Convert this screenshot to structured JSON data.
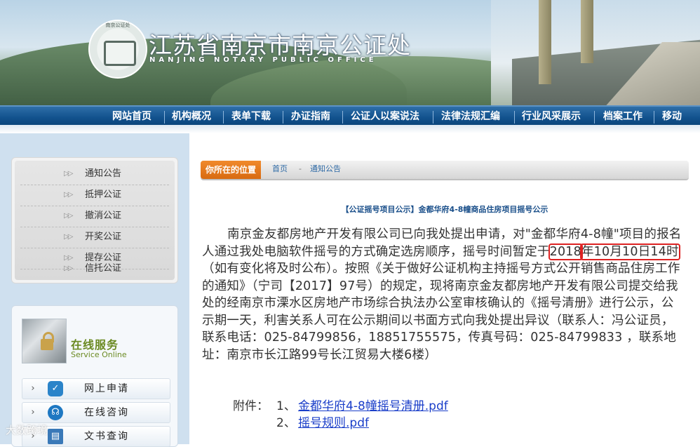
{
  "header": {
    "title": "江苏省南京市南京公证处",
    "subtitle": "NANJING NOTARY PUBLIC OFFICE",
    "logo_ring_text": "南京公证处",
    "logo_side_text": "NANJING NOTARY PUBLIC OFFICE"
  },
  "nav": {
    "items": [
      "网站首页",
      "机构概况",
      "表单下载",
      "办证指南",
      "公证人以案说法",
      "法律法规汇编",
      "行业风采展示",
      "档案工作",
      "移动"
    ]
  },
  "sidebar": {
    "menu": [
      "通知公告",
      "抵押公证",
      "撤消公证",
      "开奖公证",
      "提存公证",
      "信托公证"
    ],
    "arrow_glyph": "▷▷",
    "service_title": "在线服务",
    "service_subtitle": "Service Online",
    "service_items": [
      "网上申请",
      "在线咨询",
      "文书查询"
    ]
  },
  "breadcrumb": {
    "tag": "你所在的位置",
    "home": "首页",
    "separator": "-",
    "current": "通知公告"
  },
  "article": {
    "title": "【公证摇号项目公示】金都华府4-8幢商品住房项目摇号公示",
    "body_part1": "南京金友都房地产开发有限公司已向我处提出申请，对\"金都华府4-8幢\"项目的报名人通过我处电脑软件摇号的方式确定选房顺序，摇号时间暂定于",
    "highlight_a": "2018",
    "highlight_b": "年10月10日14时",
    "body_part2": "（如有变化将及时公布）。按照《关于做好公证机构主持摇号方式公开销售商品住房工作的通知》（宁司【2017】97号）的规定，现将南京金友都房地产开发有限公司提交给我处的经南京市溧水区房地产市场综合执法办公室审核确认的《摇号清册》进行公示，公示期一天，利害关系人可在公示期间以书面方式向我处提出异议（联系人：冯公证员，联系电话：025-84799856，18851755575，传真号码：025-84799833 ，联系地址：南京市长江路99号长江贸易大楼6楼）",
    "attachments_label": "附件：",
    "attachments": [
      {
        "index": "1、",
        "name": "金都华府4-8幢摇号清册.pdf"
      },
      {
        "index": "2、",
        "name": "摇号规则.pdf"
      }
    ]
  },
  "watermark": "大数跨境",
  "colors": {
    "nav_bg": "#12528e",
    "sidebar_bg": "#cfe0ef",
    "breadcrumb_tag": "#e07214",
    "title_color": "#1a4f8a",
    "link_color": "#1a3ec9",
    "highlight_border": "#d22222",
    "service_green": "#6b8a22"
  }
}
